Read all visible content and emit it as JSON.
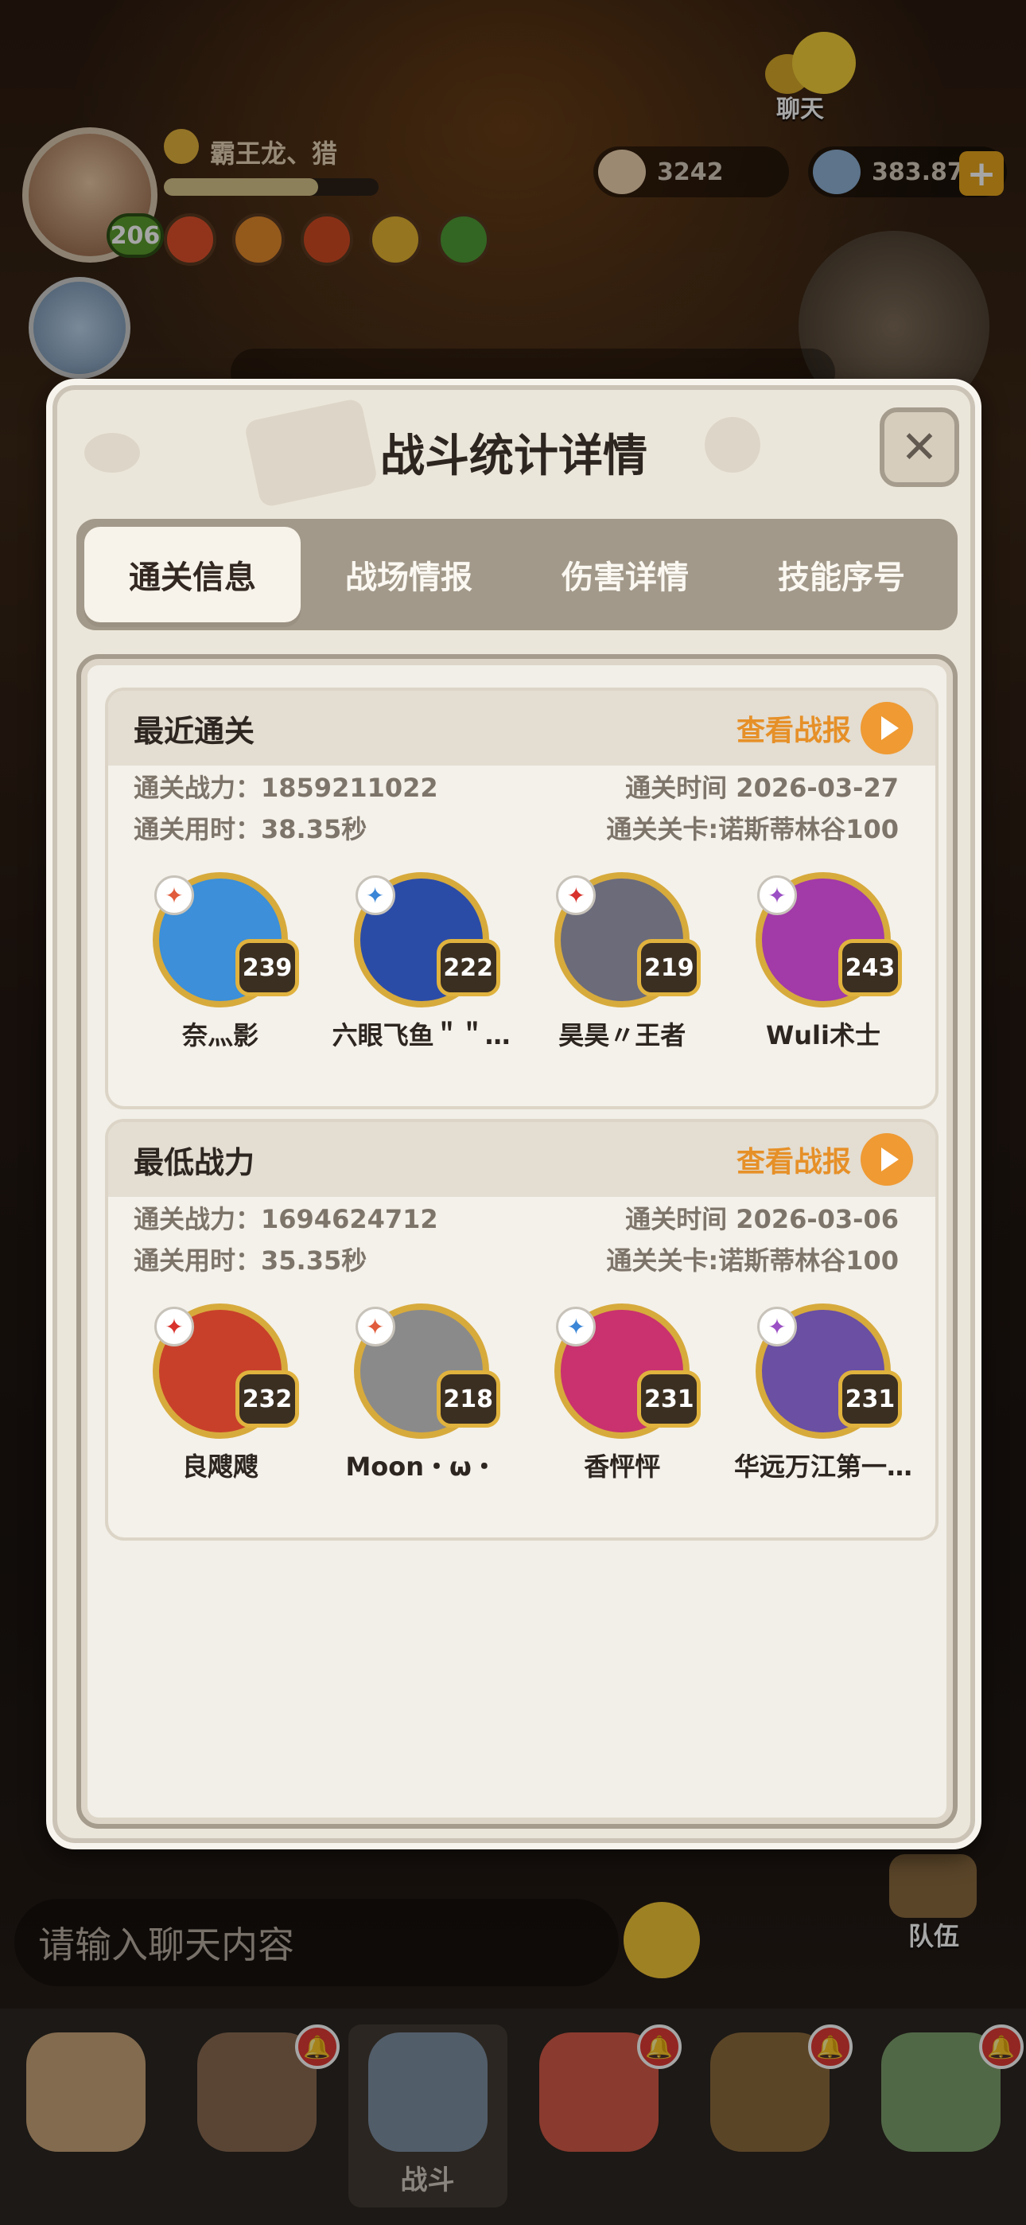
{
  "hud": {
    "player_name": "霸王龙、猎",
    "level": "206",
    "currency_1": "3242",
    "currency_2": "383.87M",
    "plus": "+",
    "chat_label": "聊天",
    "team_label": "队伍"
  },
  "chat": {
    "placeholder": "请输入聊天内容"
  },
  "bottom_nav": [
    {
      "label": ""
    },
    {
      "label": ""
    },
    {
      "label": "战斗"
    },
    {
      "label": ""
    },
    {
      "label": ""
    },
    {
      "label": ""
    }
  ],
  "modal": {
    "title": "战斗统计详情",
    "close_symbol": "✕",
    "tabs": [
      "通关信息",
      "战场情报",
      "伤害详情",
      "技能序号"
    ],
    "active_tab": "通关信息"
  },
  "sections": [
    {
      "title": "最近通关",
      "link": "查看战报",
      "power": "通关战力：1859211022",
      "time": "通关时间  2026-03-27",
      "duration": "通关用时：38.35秒",
      "stage": "通关关卡:诺斯蒂林谷100",
      "heroes": [
        {
          "name": "奈灬影",
          "level": "239",
          "color": "#3c8fd8"
        },
        {
          "name": "六眼飞鱼＂＂…",
          "level": "222",
          "color": "#2b4ca6"
        },
        {
          "name": "昊昊〃王者",
          "level": "219",
          "color": "#6b6b7a"
        },
        {
          "name": "Wuli术士",
          "level": "243",
          "color": "#a23aa8"
        }
      ]
    },
    {
      "title": "最低战力",
      "link": "查看战报",
      "power": "通关战力：1694624712",
      "time": "通关时间  2026-03-06",
      "duration": "通关用时：35.35秒",
      "stage": "通关关卡:诺斯蒂林谷100",
      "heroes": [
        {
          "name": "良飕飕",
          "level": "232",
          "color": "#c8402a"
        },
        {
          "name": "Moon・ω・",
          "level": "218",
          "color": "#8a8a8a"
        },
        {
          "name": "香怦怦",
          "level": "231",
          "color": "#c9326e"
        },
        {
          "name": "华远万江第一…",
          "level": "231",
          "color": "#6a4fa3"
        }
      ]
    }
  ],
  "colors": {
    "accent": "#e69028",
    "panel": "#ebe6da",
    "tab_bg": "#a2998a"
  }
}
